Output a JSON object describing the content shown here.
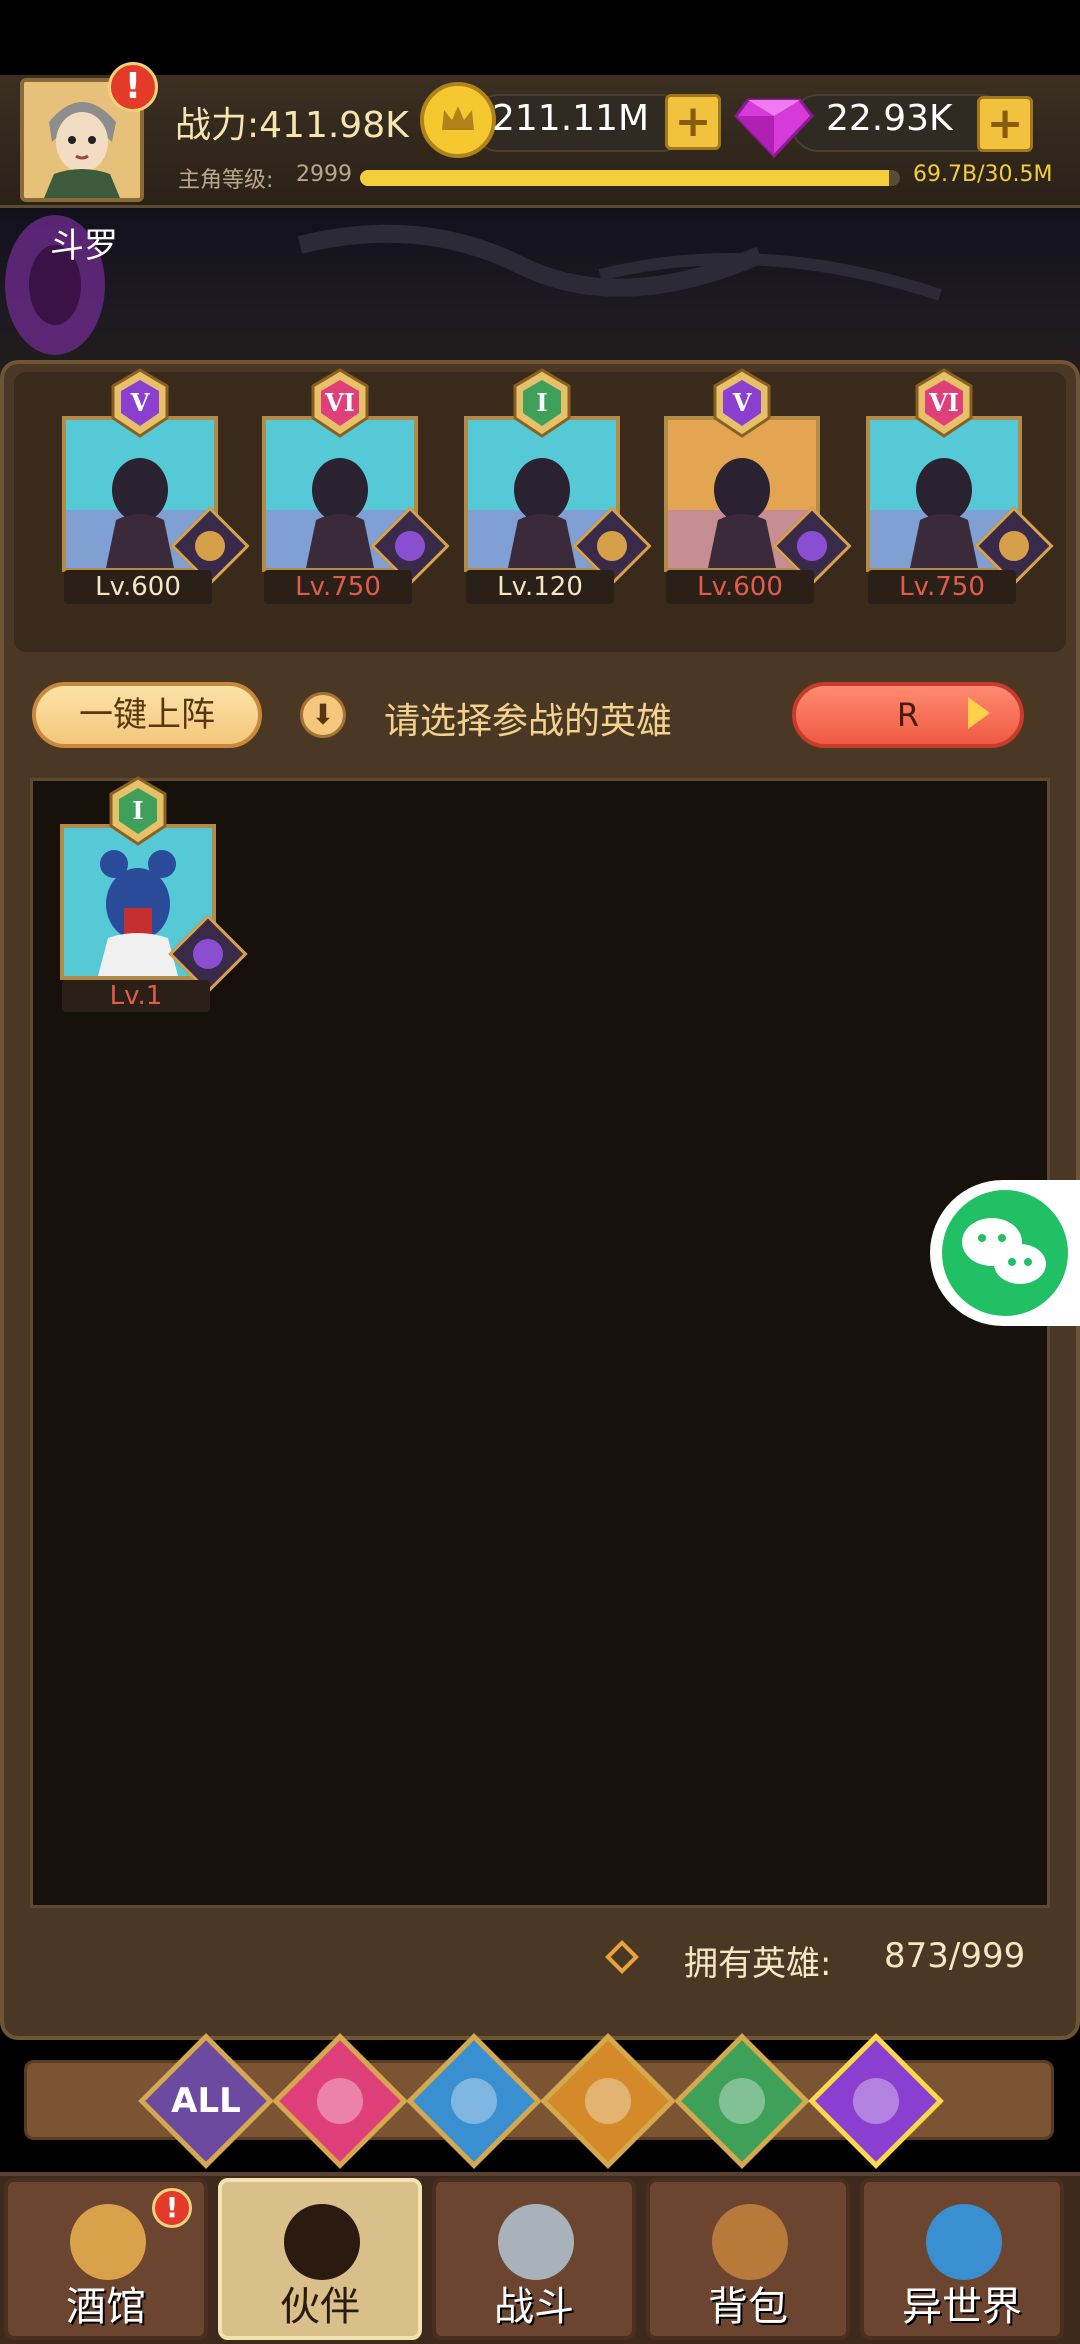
{
  "header": {
    "power_label": "战力:411.98K",
    "level_label": "主角等级:",
    "level_value": "2999",
    "xp_text": "69.7B/30.5M",
    "xp_progress": 0.98,
    "gold": "211.11M",
    "gems": "22.93K",
    "player_name": "斗罗",
    "alert": "!"
  },
  "team": [
    {
      "rank": "V",
      "level": "Lv.600",
      "level_color": "#f3e7c4",
      "bg": "#56c9d6",
      "faction": "lion",
      "faction_color": "#d6a04a"
    },
    {
      "rank": "VI",
      "level": "Lv.750",
      "level_color": "#e35b4a",
      "bg": "#56c9d6",
      "faction": "demon",
      "faction_color": "#8a4fd0"
    },
    {
      "rank": "I",
      "level": "Lv.120",
      "level_color": "#f3e7c4",
      "bg": "#56c9d6",
      "faction": "lion",
      "faction_color": "#d6a04a"
    },
    {
      "rank": "V",
      "level": "Lv.600",
      "level_color": "#e35b4a",
      "bg": "#e3a552",
      "faction": "demon",
      "faction_color": "#8a4fd0"
    },
    {
      "rank": "VI",
      "level": "Lv.750",
      "level_color": "#e35b4a",
      "bg": "#56c9d6",
      "faction": "lion",
      "faction_color": "#d6a04a"
    }
  ],
  "controls": {
    "auto_deploy": "一键上阵",
    "hint": "请选择参战的英雄",
    "rarity": "R"
  },
  "pool": [
    {
      "rank": "I",
      "level": "Lv.1",
      "level_color": "#e35b4a",
      "faction": "demon"
    }
  ],
  "owned": {
    "label": "拥有英雄:",
    "value": "873/999"
  },
  "filters": [
    {
      "name": "all",
      "label": "ALL",
      "color": "#6b4aa0"
    },
    {
      "name": "knight",
      "label": "",
      "color": "#e0407a"
    },
    {
      "name": "fish",
      "label": "",
      "color": "#3a8fd0"
    },
    {
      "name": "lion",
      "label": "",
      "color": "#d58a2a"
    },
    {
      "name": "elf",
      "label": "",
      "color": "#3fa05a"
    },
    {
      "name": "demon",
      "label": "",
      "color": "#8a3fd0"
    }
  ],
  "nav": [
    {
      "label": "酒馆",
      "icon": "mug-icon"
    },
    {
      "label": "伙伴",
      "icon": "partner-icon"
    },
    {
      "label": "战斗",
      "icon": "swords-icon"
    },
    {
      "label": "背包",
      "icon": "backpack-icon"
    },
    {
      "label": "异世界",
      "icon": "portal-icon"
    }
  ]
}
